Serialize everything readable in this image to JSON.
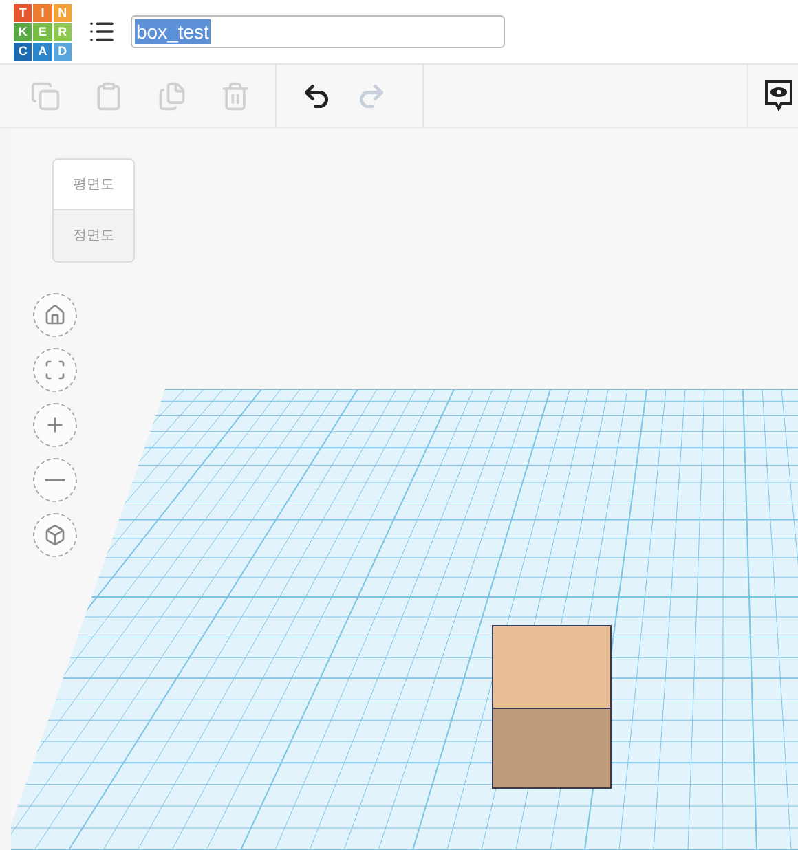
{
  "logo": [
    {
      "letter": "T",
      "color": "#e4572e"
    },
    {
      "letter": "I",
      "color": "#ef7d31"
    },
    {
      "letter": "N",
      "color": "#f3a23a"
    },
    {
      "letter": "K",
      "color": "#5aa844"
    },
    {
      "letter": "E",
      "color": "#78bb47"
    },
    {
      "letter": "R",
      "color": "#8fc850"
    },
    {
      "letter": "C",
      "color": "#1d6ab0"
    },
    {
      "letter": "A",
      "color": "#2c86cc"
    },
    {
      "letter": "D",
      "color": "#58a6dc"
    }
  ],
  "title_field": {
    "value": "box_test",
    "selected": true
  },
  "toolbar": [
    {
      "kind": "copy",
      "disabled": true
    },
    {
      "kind": "paste",
      "disabled": true
    },
    {
      "kind": "duplicate",
      "disabled": true
    },
    {
      "kind": "delete",
      "disabled": true
    },
    {
      "kind": "undo",
      "disabled": false
    },
    {
      "kind": "redo",
      "disabled": true
    }
  ],
  "view_cube": {
    "top": "평면도",
    "front": "정면도"
  },
  "nav_buttons": [
    {
      "kind": "home"
    },
    {
      "kind": "fit"
    },
    {
      "kind": "zoom_in"
    },
    {
      "kind": "zoom_out"
    },
    {
      "kind": "ortho"
    }
  ]
}
